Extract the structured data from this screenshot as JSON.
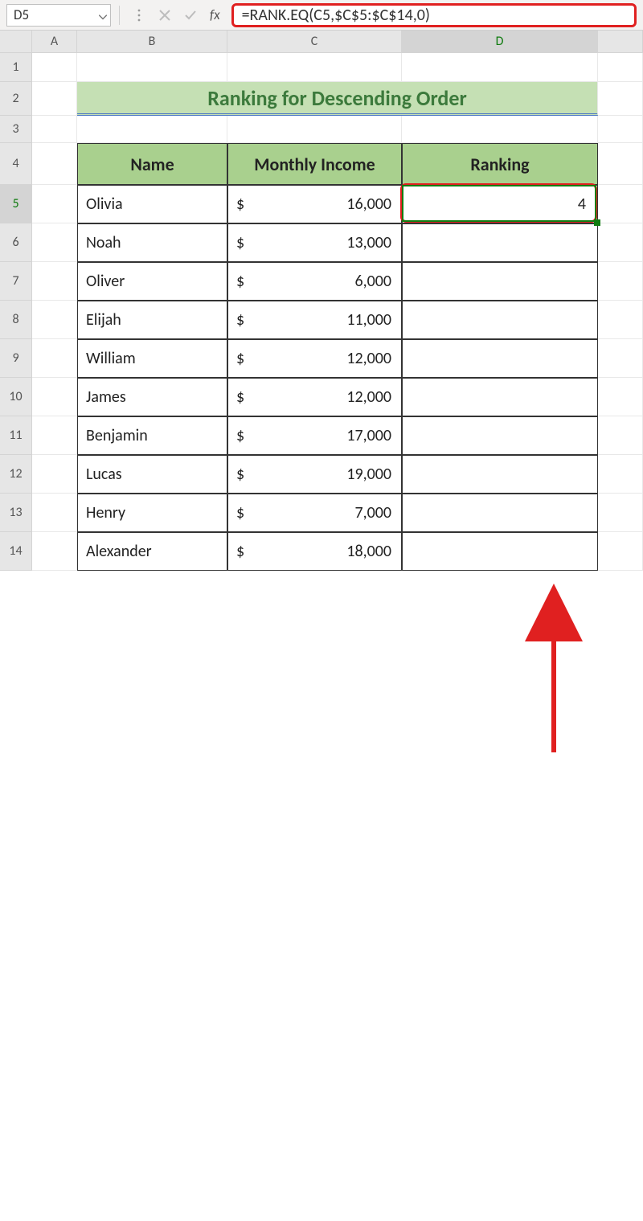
{
  "nameBox": {
    "value": "D5"
  },
  "formulaBar": {
    "formula": "=RANK.EQ(C5,$C$5:$C$14,0)"
  },
  "columns": {
    "A": "A",
    "B": "B",
    "C": "C",
    "D": "D"
  },
  "rowNums": [
    "1",
    "2",
    "3",
    "4",
    "5",
    "6",
    "7",
    "8",
    "9",
    "10",
    "11",
    "12",
    "13",
    "14"
  ],
  "title": "Ranking for Descending Order",
  "headers": {
    "name": "Name",
    "income": "Monthly Income",
    "ranking": "Ranking"
  },
  "currency": "$",
  "rows": [
    {
      "name": "Olivia",
      "income": "16,000",
      "rank": "4"
    },
    {
      "name": "Noah",
      "income": "13,000",
      "rank": ""
    },
    {
      "name": "Oliver",
      "income": "6,000",
      "rank": ""
    },
    {
      "name": "Elijah",
      "income": "11,000",
      "rank": ""
    },
    {
      "name": "William",
      "income": "12,000",
      "rank": ""
    },
    {
      "name": "James",
      "income": "12,000",
      "rank": ""
    },
    {
      "name": "Benjamin",
      "income": "17,000",
      "rank": ""
    },
    {
      "name": "Lucas",
      "income": "19,000",
      "rank": ""
    },
    {
      "name": "Henry",
      "income": "7,000",
      "rank": ""
    },
    {
      "name": "Alexander",
      "income": "18,000",
      "rank": ""
    }
  ],
  "icons": {
    "dropdown": "chevron-down-icon",
    "cancel": "x-icon",
    "enter": "check-icon",
    "fx": "fx",
    "dots": "dots-icon"
  },
  "chart_data": {
    "type": "table",
    "title": "Ranking for Descending Order",
    "columns": [
      "Name",
      "Monthly Income",
      "Ranking"
    ],
    "rows": [
      [
        "Olivia",
        16000,
        4
      ],
      [
        "Noah",
        13000,
        null
      ],
      [
        "Oliver",
        6000,
        null
      ],
      [
        "Elijah",
        11000,
        null
      ],
      [
        "William",
        12000,
        null
      ],
      [
        "James",
        12000,
        null
      ],
      [
        "Benjamin",
        17000,
        null
      ],
      [
        "Lucas",
        19000,
        null
      ],
      [
        "Henry",
        7000,
        null
      ],
      [
        "Alexander",
        18000,
        null
      ]
    ]
  }
}
